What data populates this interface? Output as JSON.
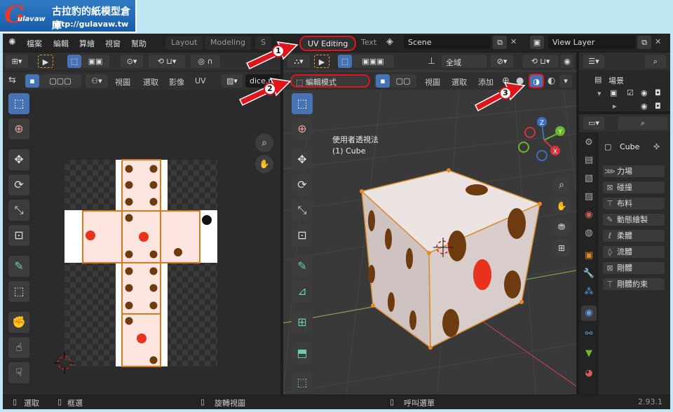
{
  "banner": {
    "logo_letter": "G",
    "brand": "ulavaw",
    "title": "古拉豹的紙模型倉庫",
    "url": "http://gulavaw.tw"
  },
  "topbar": {
    "menus": [
      "檔案",
      "編輯",
      "算繪",
      "視窗",
      "幫助"
    ],
    "workspaces": [
      "Layout",
      "Modeling",
      "S",
      "UV Editing",
      "Text"
    ],
    "scene": "Scene",
    "view_layer": "View Layer"
  },
  "uv_editor": {
    "menus": [
      "視圖",
      "選取",
      "影像",
      "UV"
    ],
    "image_name": "dice.png"
  },
  "viewport": {
    "mode": "編輯模式",
    "menus": [
      "視圖",
      "選取",
      "添加"
    ],
    "orientation": "全域",
    "perspective_label": "使用者透視法",
    "object_label": "(1) Cube",
    "gizmo_axes": [
      "X",
      "Y",
      "Z"
    ]
  },
  "outliner": {
    "item": "場景"
  },
  "properties": {
    "object_name": "Cube",
    "buttons": [
      "力場",
      "碰撞",
      "布料",
      "動態繪製",
      "柔體",
      "流體",
      "剛體",
      "剛體約束"
    ]
  },
  "statusbar": {
    "select": "選取",
    "box_select": "框選",
    "rotate_view": "旋轉視圖",
    "call_menu": "呼叫選單",
    "version": "2.93.1"
  },
  "annotations": [
    "1",
    "2",
    "3"
  ],
  "colors": {
    "highlight": "#e0141b",
    "accent": "#4772b3",
    "dot": "#6e3a0f",
    "dot_red": "#e8321e"
  }
}
